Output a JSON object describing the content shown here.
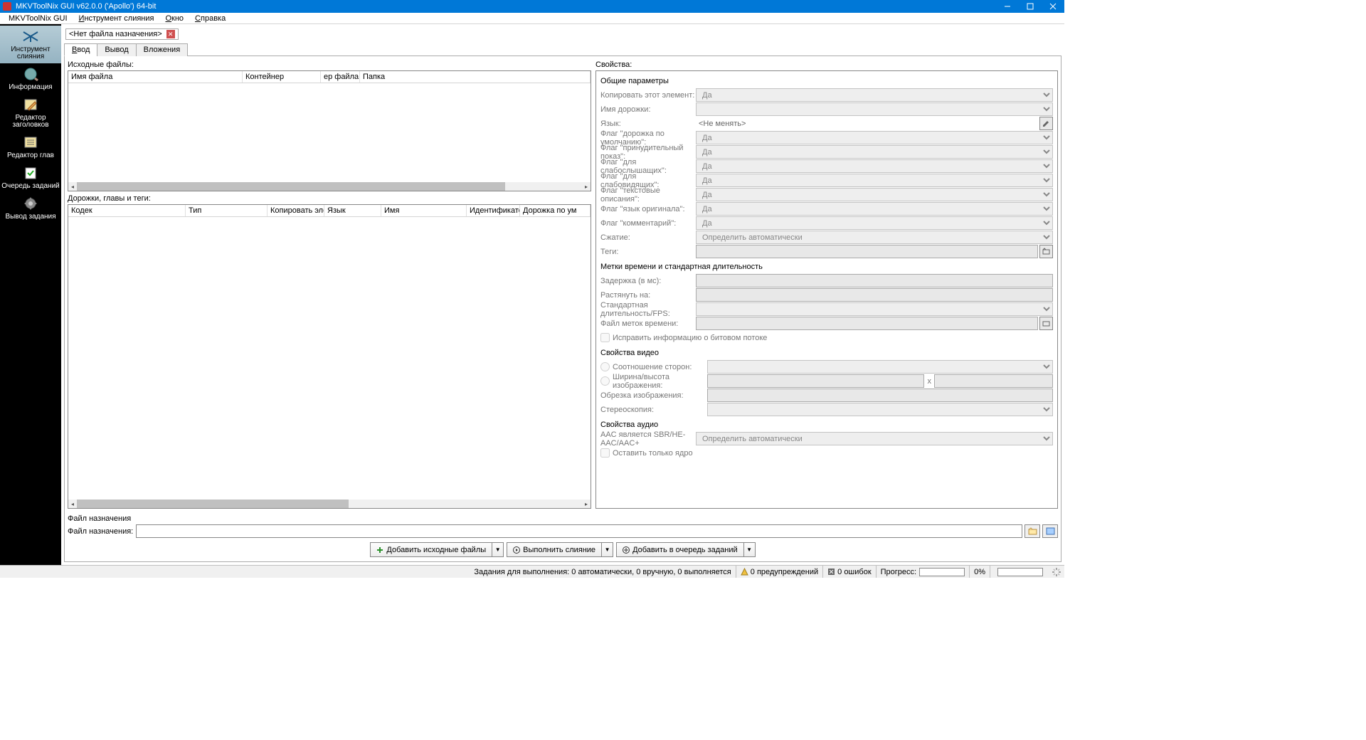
{
  "title": "MKVToolNix GUI v62.0.0 ('Apollo') 64-bit",
  "menu": {
    "m0": "MKVToolNix GUI",
    "m1": "Инструмент слияния",
    "m2": "Окно",
    "m3": "Справка"
  },
  "sidebar": {
    "merge": "Инструмент слияния",
    "info": "Информация",
    "header": "Редактор заголовков",
    "chapters": "Редактор глав",
    "queue": "Очередь заданий",
    "output": "Вывод задания"
  },
  "filetab": {
    "label": "<Нет файла назначения>"
  },
  "tabs": {
    "input": "Ввод",
    "output": "Вывод",
    "attach": "Вложения"
  },
  "srcfiles": {
    "label": "Исходные файлы:",
    "cols": {
      "name": "Имя файла",
      "container": "Контейнер",
      "filesize": "ер файла",
      "folder": "Папка"
    }
  },
  "tracks": {
    "label": "Дорожки, главы и теги:",
    "cols": {
      "codec": "Кодек",
      "type": "Тип",
      "copy": "Копировать элем",
      "lang": "Язык",
      "name": "Имя",
      "id": "Идентификатор",
      "def": "Дорожка по ум"
    }
  },
  "props": {
    "header": "Свойства:",
    "g_general": "Общие параметры",
    "copy_item": "Копировать этот элемент:",
    "track_name": "Имя дорожки:",
    "lang": "Язык:",
    "lang_val": "<Не менять>",
    "flag_default": "Флаг \"дорожка по умолчанию\":",
    "flag_forced": "Флаг \"принудительный показ\":",
    "flag_hearing": "Флаг \"для слабослышащих\":",
    "flag_visual": "Флаг \"для слабовидящих\":",
    "flag_textdesc": "Флаг \"текстовые описания\":",
    "flag_origlang": "Флаг \"язык оригинала\":",
    "flag_comment": "Флаг \"комментарий\":",
    "compress": "Сжатие:",
    "tags": "Теги:",
    "yes": "Да",
    "auto": "Определить автоматически",
    "g_time": "Метки времени и стандартная длительность",
    "delay": "Задержка (в мс):",
    "stretch": "Растянуть на:",
    "fps": "Стандартная длительность/FPS:",
    "tsfile": "Файл меток времени:",
    "fix_bitstream": "Исправить информацию о битовом потоке",
    "g_video": "Свойства видео",
    "aspect": "Соотношение сторон:",
    "whimg": "Ширина/высота изображения:",
    "crop": "Обрезка изображения:",
    "stereo": "Стереоскопия:",
    "g_audio": "Свойства аудио",
    "aac": "AAC является SBR/HE-AAC/AAC+",
    "core_only": "Оставить только ядро"
  },
  "dest": {
    "section": "Файл назначения",
    "label": "Файл назначения:"
  },
  "actions": {
    "add_src": "Добавить исходные файлы",
    "mux": "Выполнить слияние",
    "queue": "Добавить в очередь заданий"
  },
  "status": {
    "jobs_lbl": "Задания для выполнения:",
    "jobs_val": "0 автоматически, 0 вручную, 0 выполняется",
    "warn": "0 предупреждений",
    "err": "0 ошибок",
    "progress": "Прогресс:",
    "pct": "0%"
  }
}
